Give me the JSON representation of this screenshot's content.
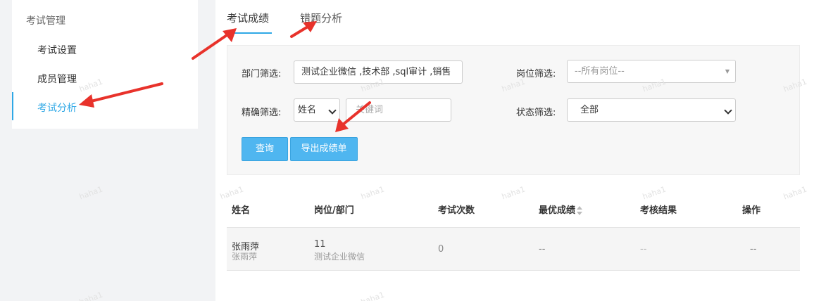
{
  "sidebar": {
    "group_title": "考试管理",
    "items": [
      {
        "label": "考试设置"
      },
      {
        "label": "成员管理"
      },
      {
        "label": "考试分析"
      }
    ]
  },
  "tabs": [
    {
      "label": "考试成绩"
    },
    {
      "label": "错题分析"
    }
  ],
  "filters": {
    "dept_label": "部门筛选:",
    "dept_value": "测试企业微信 ,技术部 ,sql审计 ,销售",
    "post_label": "岗位筛选:",
    "post_value": "--所有岗位--",
    "exact_label": "精确筛选:",
    "exact_field": "姓名",
    "keyword_placeholder": "关键词",
    "status_label": "状态筛选:",
    "status_value": "全部",
    "query_button": "查询",
    "export_button": "导出成绩单"
  },
  "table": {
    "headers": [
      "姓名",
      "岗位/部门",
      "考试次数",
      "最优成绩",
      "考核结果",
      "操作"
    ],
    "rows": [
      {
        "name": "张雨萍",
        "name_sub": "张雨萍",
        "post": "11",
        "dept": "测试企业微信",
        "attempts": "0",
        "best_score": "--",
        "result": "--",
        "action": "--"
      }
    ]
  },
  "watermark": "haha1",
  "colors": {
    "accent": "#2fa8e6",
    "button": "#4fb6f0",
    "annotation_arrow": "#e8322b"
  }
}
